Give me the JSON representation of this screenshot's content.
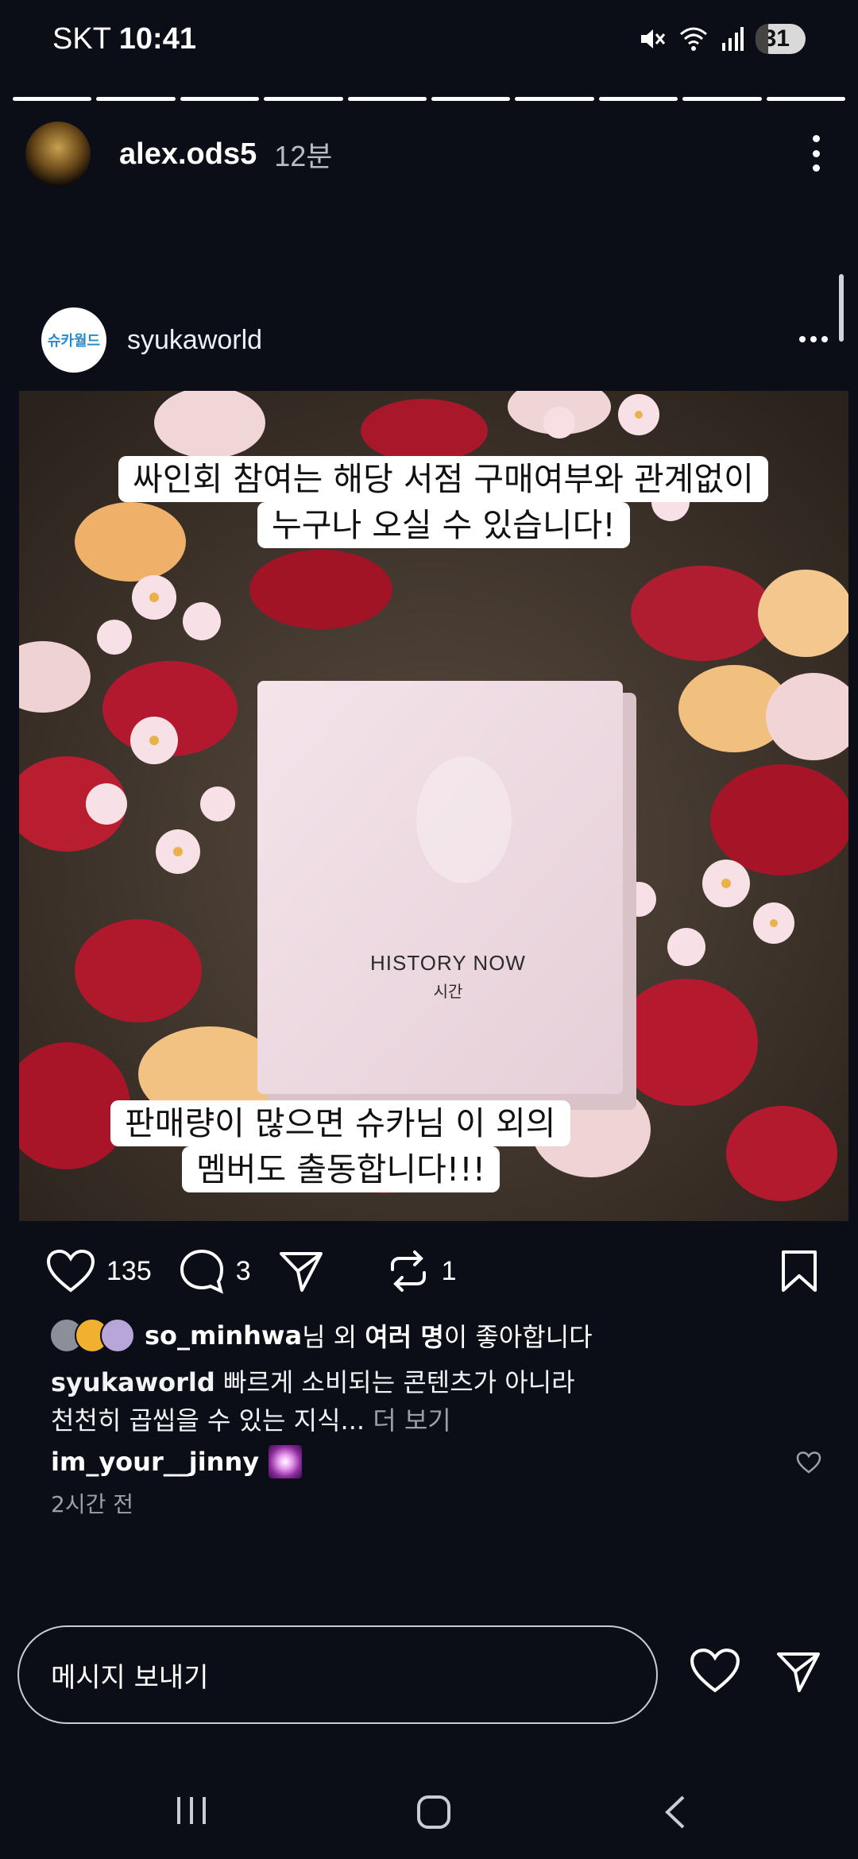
{
  "status_bar": {
    "carrier": "SKT",
    "time": "10:41",
    "battery": "31"
  },
  "story": {
    "username": "alex.ods5",
    "time_ago": "12분",
    "segments": 10
  },
  "post": {
    "username": "syukaworld",
    "avatar_text": "슈카월드",
    "caption_top_line1": "싸인회 참여는 해당 서점 구매여부와 관계없이",
    "caption_top_line2": "누구나 오실 수 있습니다!",
    "book_title": "HISTORY NOW",
    "book_subtitle": "시간",
    "caption_bottom_line1": "판매량이 많으면 슈카님 이 외의",
    "caption_bottom_line2": "멤버도 출동합니다!!!"
  },
  "actions": {
    "likes_count": "135",
    "comments_count": "3",
    "reposts_count": "1"
  },
  "likes_line": {
    "liker": "so_minhwa",
    "middle": "님 외 ",
    "others_bold": "여러 명",
    "suffix": "이 좋아합니다"
  },
  "caption": {
    "username": "syukaworld",
    "text_line1": " 빠르게 소비되는 콘텐츠가 아니라",
    "text_line2": "천천히 곱씹을 수 있는 지식...",
    "more": " 더 보기"
  },
  "comment": {
    "username": "im_your__jinny"
  },
  "post_time": "2시간 전",
  "message_bar": {
    "placeholder": "메시지 보내기"
  },
  "colors": {
    "background": "#0b0e17",
    "text": "#ffffff",
    "muted": "#9aa0aa"
  }
}
